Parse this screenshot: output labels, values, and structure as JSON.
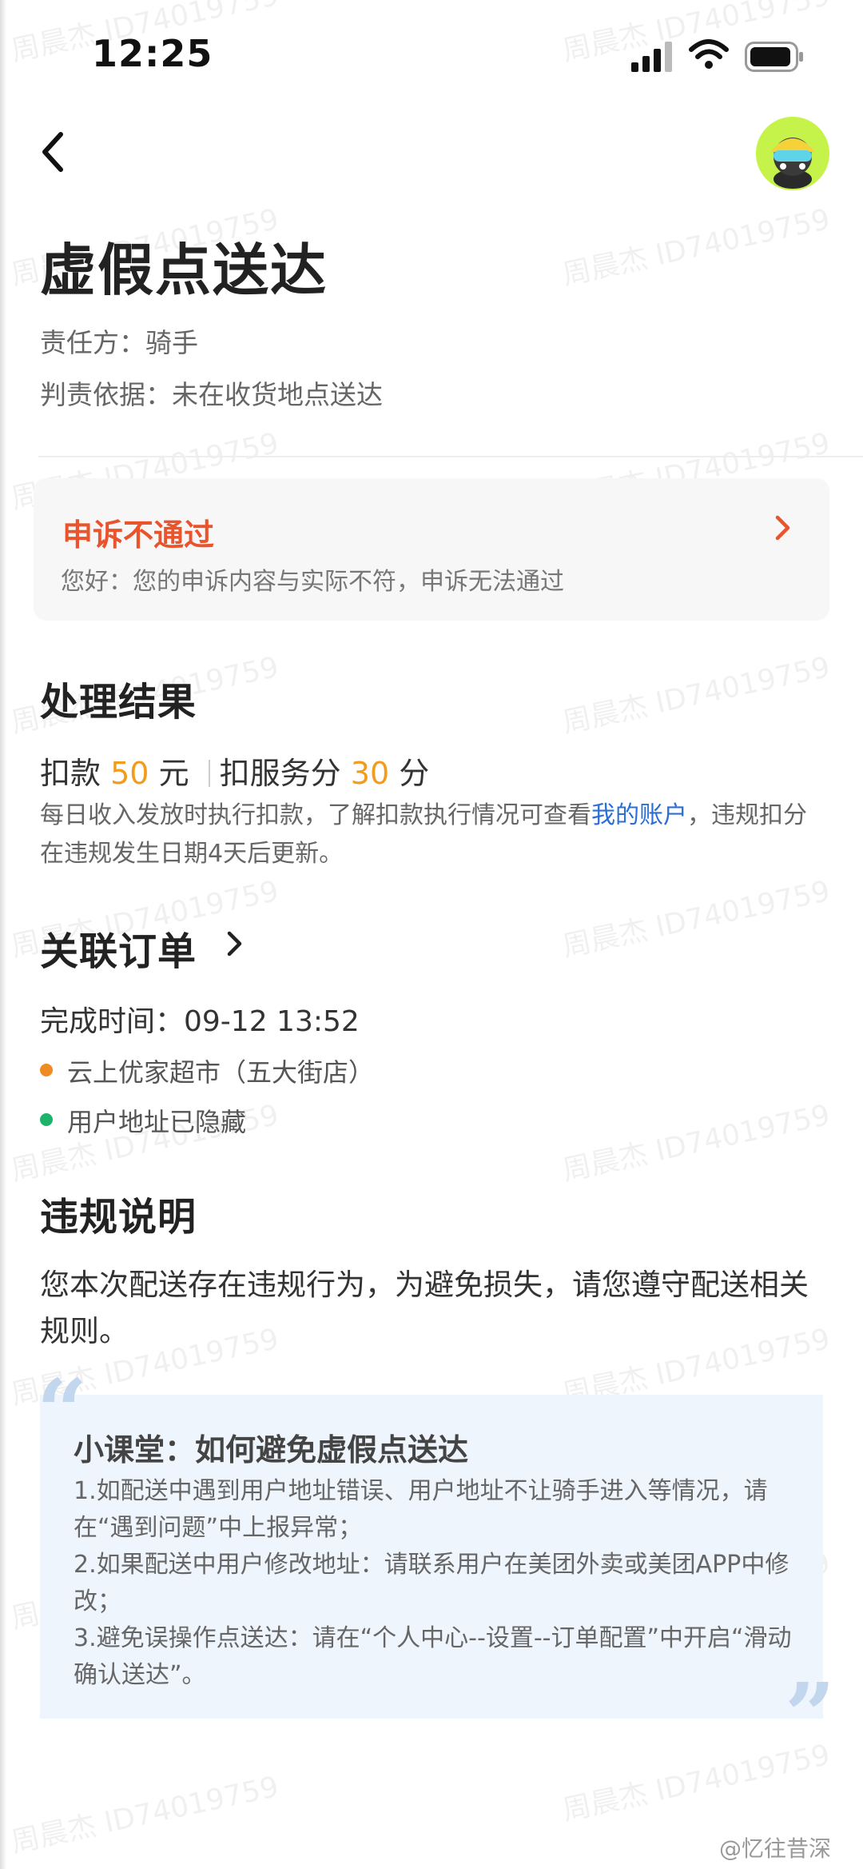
{
  "status_bar": {
    "time": "12:25"
  },
  "header": {
    "title": "虚假点送达"
  },
  "meta": {
    "responsible": "责任方：骑手",
    "basis": "判责依据：未在收货地点送达"
  },
  "appeal": {
    "status": "申诉不通过",
    "message": "您好：您的申诉内容与实际不符，申诉无法通过"
  },
  "result": {
    "heading": "处理结果",
    "deduct_prefix": "扣款",
    "deduct_amount": "50",
    "deduct_unit": "元",
    "points_prefix": "扣服务分",
    "points_amount": "30",
    "points_unit": "分",
    "note_part1": "每日收入发放时执行扣款，了解扣款执行情况可查看",
    "note_link": "我的账户",
    "note_part2": "，违规扣分在违规发生日期4天后更新。"
  },
  "order": {
    "heading": "关联订单",
    "finish_time": "完成时间：09-12 13:52",
    "store": "云上优家超市（五大街店）",
    "address": "用户地址已隐藏"
  },
  "violation": {
    "heading": "违规说明",
    "text": "您本次配送存在违规行为，为避免损失，请您遵守配送相关规则。"
  },
  "tips": {
    "title": "小课堂：如何避免虚假点送达",
    "items": [
      "1.如配送中遇到用户地址错误、用户地址不让骑手进入等情况，请在“遇到问题”中上报异常；",
      "2.如果配送中用户修改地址：请联系用户在美团外卖或美团APP中修改；",
      "3.避免误操作点送达：请在“个人中心--设置--订单配置”中开启“滑动确认送达”。"
    ]
  },
  "watermark": "周晨杰 ID74019759",
  "credit": "@忆往昔深",
  "colors": {
    "accent_red": "#e9542d",
    "amount_orange": "#f39b1d",
    "link_blue": "#2a6fd8",
    "store_dot": "#f08a24",
    "address_dot": "#1db36b",
    "tip_bg": "#eff5fc"
  }
}
